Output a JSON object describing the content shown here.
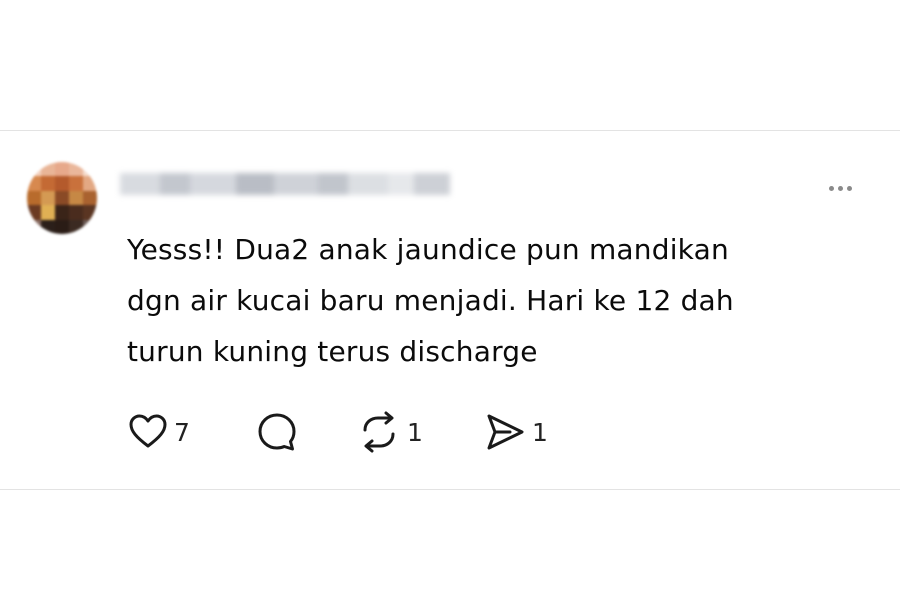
{
  "post": {
    "author": {
      "avatar_blurred": true,
      "username_blurred": true
    },
    "text_lines": [
      "Yesss!! Dua2 anak jaundice pun mandikan",
      "dgn air kucai baru menjadi. Hari ke 12 dah",
      "turun kuning terus discharge"
    ],
    "actions": {
      "like": {
        "icon": "heart-icon",
        "count": "7"
      },
      "reply": {
        "icon": "comment-icon",
        "count": ""
      },
      "repost": {
        "icon": "repost-icon",
        "count": "1"
      },
      "share": {
        "icon": "send-icon",
        "count": "1"
      }
    },
    "more_icon": "more-horizontal-icon"
  },
  "colors": {
    "text": "#0b0b0b",
    "icon": "#1a1a1a",
    "divider": "#e3e3e3",
    "muted": "#8a8a8a"
  }
}
